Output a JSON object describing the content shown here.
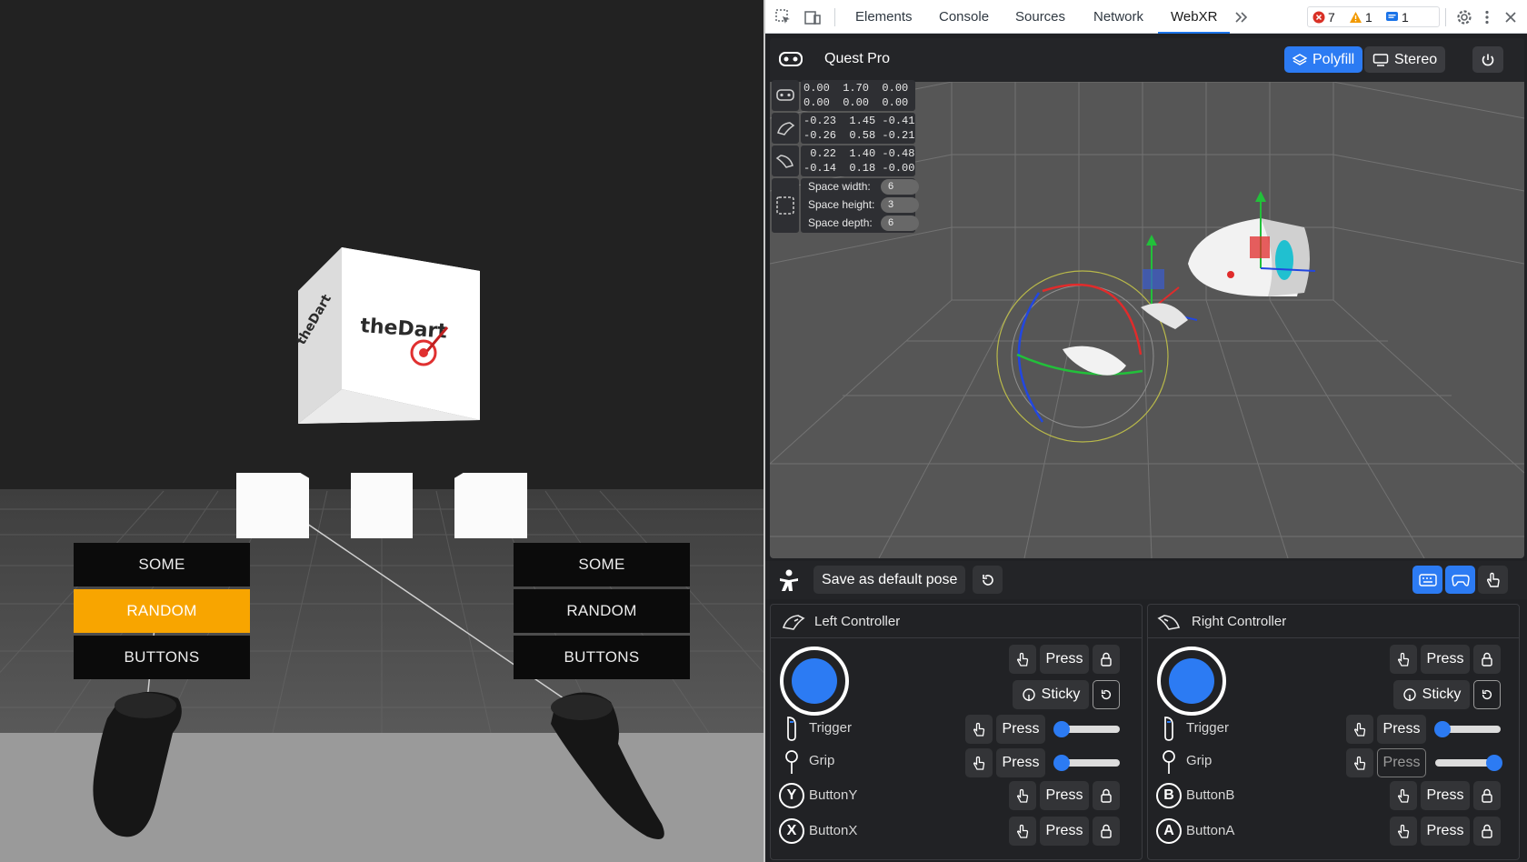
{
  "scene": {
    "cube_logo": "theDart",
    "left_menu": [
      {
        "label": "SOME",
        "active": false
      },
      {
        "label": "RANDOM",
        "active": true
      },
      {
        "label": "BUTTONS",
        "active": false
      }
    ],
    "right_menu": [
      {
        "label": "SOME",
        "active": false
      },
      {
        "label": "RANDOM",
        "active": false
      },
      {
        "label": "BUTTONS",
        "active": false
      }
    ],
    "colors": {
      "active_button": "#f8a500",
      "inactive_button": "#0b0b0b",
      "floor": "#4a4a4a",
      "sky": "#222222"
    }
  },
  "devtools": {
    "tabs": [
      "Elements",
      "Console",
      "Sources",
      "Network",
      "WebXR"
    ],
    "active_tab": "WebXR",
    "more_tabs_icon": "chevron-double-right-icon",
    "badges": {
      "errors": "7",
      "warnings": "1",
      "messages": "1"
    },
    "colors": {
      "accent": "#2c7bf3",
      "error": "#d93025",
      "warning": "#f29900",
      "info": "#1a73e8"
    }
  },
  "webxr": {
    "device_name": "Quest Pro",
    "polyfill_label": "Polyfill",
    "stereo_label": "Stereo",
    "pose": {
      "headset": [
        "0.00  1.70  0.00",
        "0.00  0.00  0.00"
      ],
      "left_controller": [
        "-0.23  1.45 -0.41",
        "-0.26  0.58 -0.21"
      ],
      "right_controller": [
        " 0.22  1.40 -0.48",
        "-0.14  0.18 -0.00"
      ]
    },
    "space": {
      "width_label": "Space width:",
      "width_value": "6",
      "height_label": "Space height:",
      "height_value": "3",
      "depth_label": "Space depth:",
      "depth_value": "6"
    },
    "save_pose_label": "Save as default pose"
  },
  "controllers": {
    "left": {
      "title": "Left Controller",
      "press": "Press",
      "sticky": "Sticky",
      "trigger": "Trigger",
      "grip": "Grip",
      "button_top": "ButtonY",
      "button_top_letter": "Y",
      "button_bottom": "ButtonX",
      "button_bottom_letter": "X",
      "trigger_value": 0,
      "grip_value": 0
    },
    "right": {
      "title": "Right Controller",
      "press": "Press",
      "sticky": "Sticky",
      "trigger": "Trigger",
      "grip": "Grip",
      "button_top": "ButtonB",
      "button_top_letter": "B",
      "button_bottom": "ButtonA",
      "button_bottom_letter": "A",
      "trigger_value": 0,
      "grip_value": 1
    }
  }
}
